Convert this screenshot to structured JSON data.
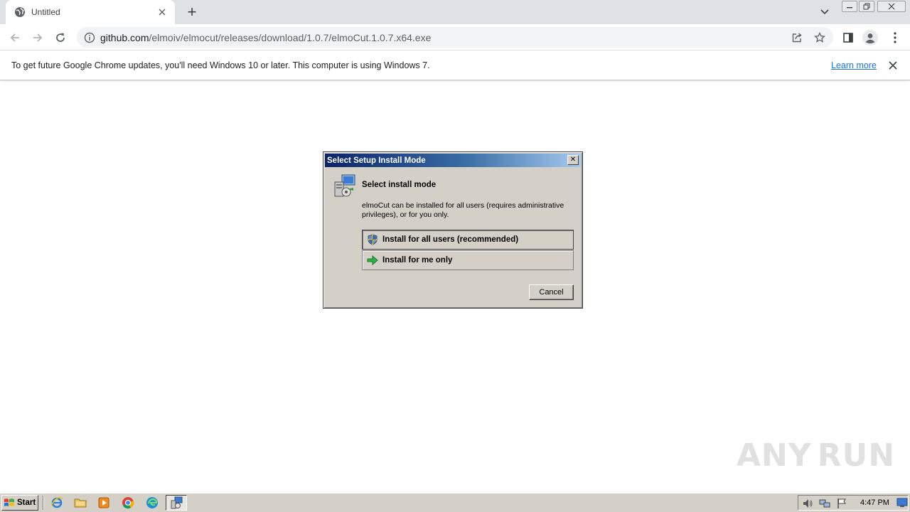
{
  "browser": {
    "tab_title": "Untitled",
    "new_tab_label": "+",
    "url_host": "github.com",
    "url_path": "/elmoiv/elmocut/releases/download/1.0.7/elmoCut.1.0.7.x64.exe"
  },
  "infobar": {
    "message": "To get future Google Chrome updates, you'll need Windows 10 or later. This computer is using Windows 7.",
    "learn_more": "Learn more"
  },
  "dialog": {
    "title": "Select Setup Install Mode",
    "close_glyph": "✕",
    "heading": "Select install mode",
    "description": "elmoCut can be installed for all users (requires administrative privileges), or for you only.",
    "option_all_users": "Install for all users (recommended)",
    "option_me_only": "Install for me only",
    "cancel": "Cancel"
  },
  "watermark": {
    "left": "ANY",
    "right": "RUN"
  },
  "taskbar": {
    "start": "Start",
    "clock": "4:47 PM"
  },
  "colors": {
    "chrome_frame": "#dee1e6",
    "omnibox": "#f1f3f4",
    "link": "#1a73e8",
    "dialog_face": "#d4d0c8",
    "title_gradient_start": "#0a246a",
    "title_gradient_end": "#a6caf0"
  }
}
